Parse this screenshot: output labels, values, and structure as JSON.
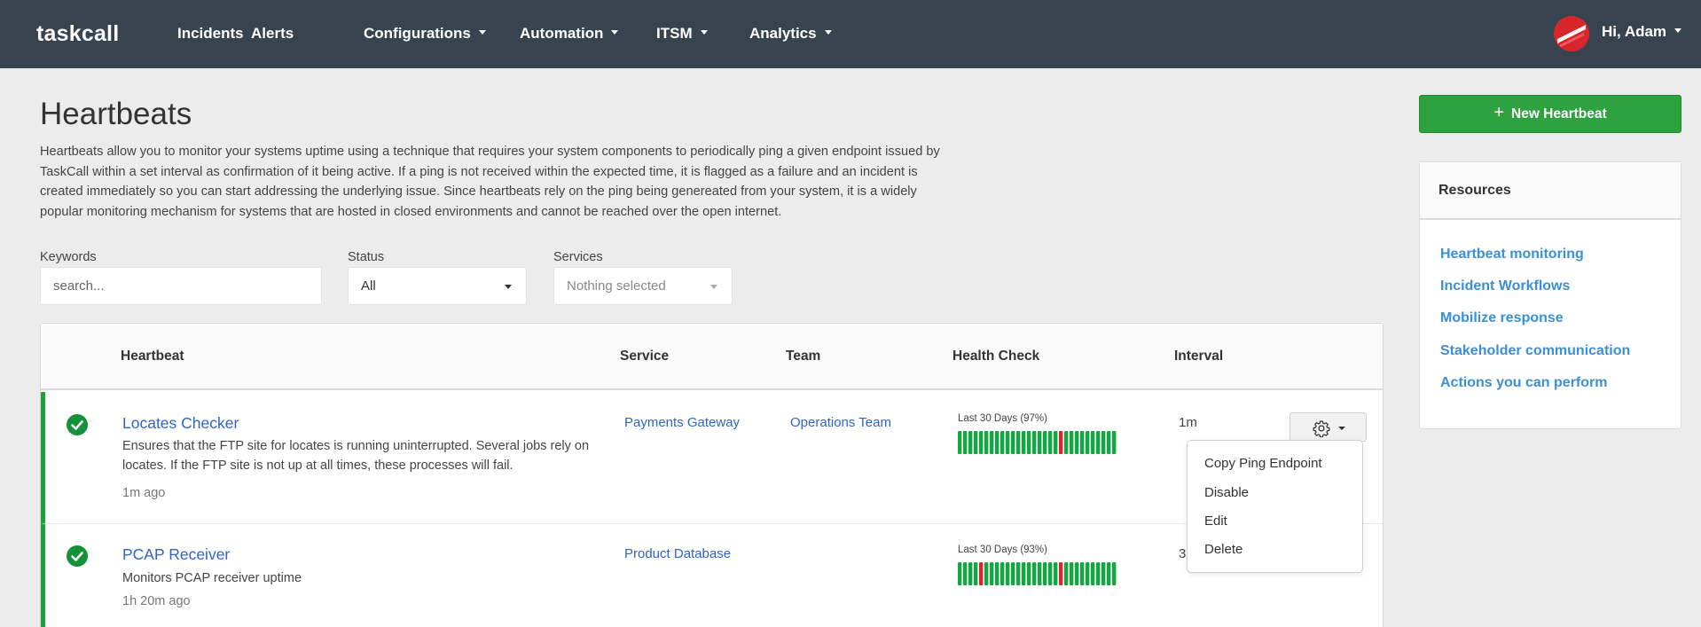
{
  "nav": {
    "brand": "taskcall",
    "items": [
      {
        "label": "Incidents",
        "dropdown": false
      },
      {
        "label": "Alerts",
        "dropdown": false
      },
      {
        "label": "Configurations",
        "dropdown": true
      },
      {
        "label": "Automation",
        "dropdown": true
      },
      {
        "label": "ITSM",
        "dropdown": true
      },
      {
        "label": "Analytics",
        "dropdown": true
      }
    ],
    "user_greeting": "Hi, Adam"
  },
  "header": {
    "title": "Heartbeats",
    "description": "Heartbeats allow you to monitor your systems uptime using a technique that requires your system components to periodically ping a given endpoint issued by TaskCall within a set interval as confirmation of it being active. If a ping is not received within the expected time, it is flagged as a failure and an incident is created immediately so you can start addressing the underlying issue. Since heartbeats rely on the ping being genereated from your system, it is a widely popular monitoring mechanism for systems that are hosted in closed environments and cannot be reached over the open internet."
  },
  "filters": {
    "keywords_label": "Keywords",
    "keywords_placeholder": "search...",
    "status_label": "Status",
    "status_value": "All",
    "services_label": "Services",
    "services_value": "Nothing selected"
  },
  "table": {
    "columns": [
      "Heartbeat",
      "Service",
      "Team",
      "Health Check",
      "Interval"
    ],
    "rows": [
      {
        "name": "Locates Checker",
        "description": "Ensures that the FTP site for locates is running uninterrupted. Several jobs rely on locates. If the FTP site is not up at all times, these processes will fail.",
        "last_ping": "1m ago",
        "service": "Payments Gateway",
        "team": "Operations Team",
        "health_label": "Last 30 Days (97%)",
        "health_failures": [
          19
        ],
        "interval": "1m"
      },
      {
        "name": "PCAP Receiver",
        "description": "Monitors PCAP receiver uptime",
        "last_ping": "1h 20m ago",
        "service": "Product Database",
        "team": "",
        "health_label": "Last 30 Days (93%)",
        "health_failures": [
          4,
          19
        ],
        "interval": "3d"
      }
    ]
  },
  "row_menu": {
    "items": [
      "Copy Ping Endpoint",
      "Disable",
      "Edit",
      "Delete"
    ]
  },
  "sidebar": {
    "new_button": "New Heartbeat",
    "resources_title": "Resources",
    "resources": [
      "Heartbeat monitoring",
      "Incident Workflows",
      "Mobilize response",
      "Stakeholder communication",
      "Actions you can perform"
    ]
  },
  "colors": {
    "navbar": "#37434f",
    "primary_green": "#2da23f",
    "link_blue": "#2f63c7",
    "resource_link": "#3b8fd5",
    "health_ok": "#16a545",
    "health_fail": "#d7282f"
  }
}
